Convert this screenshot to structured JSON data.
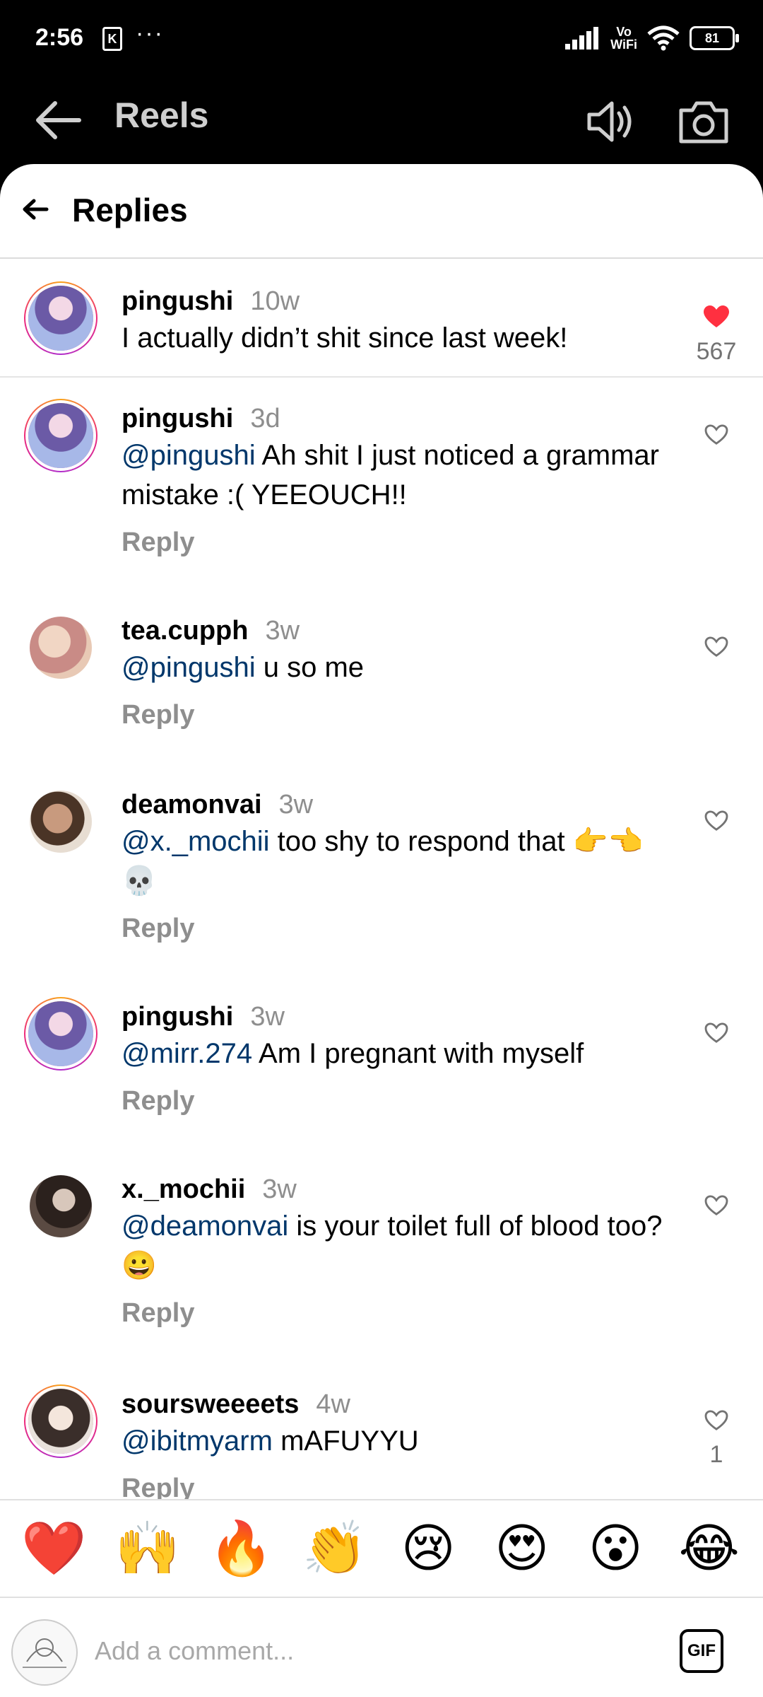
{
  "status_bar": {
    "time": "2:56",
    "k_badge": "K",
    "dots": "···",
    "vo_line1": "Vo",
    "vo_line2": "WiFi",
    "battery": "81"
  },
  "reels_header": {
    "title": "Reels",
    "back_icon": "arrow-left-icon",
    "sound_icon": "speaker-icon",
    "camera_icon": "camera-icon"
  },
  "sheet": {
    "title": "Replies",
    "back_icon": "arrow-left-icon"
  },
  "colors": {
    "mention": "#00376b",
    "like_active": "#ff3040",
    "meta_gray": "#8e8e8e"
  },
  "comments": [
    {
      "user": "pingushi",
      "time": "10w",
      "mention": "",
      "text": "I actually didn’t shit since last week!",
      "reply": "",
      "liked": true,
      "likes": "567"
    },
    {
      "user": "pingushi",
      "time": "3d",
      "mention": "@pingushi",
      "text": " Ah shit I just noticed a grammar mistake :( YEEOUCH!!",
      "reply": "Reply",
      "liked": false,
      "likes": ""
    },
    {
      "user": "tea.cupph",
      "time": "3w",
      "mention": "@pingushi",
      "text": " u so me",
      "reply": "Reply",
      "liked": false,
      "likes": ""
    },
    {
      "user": "deamonvai",
      "time": "3w",
      "mention": "@x._mochii",
      "text": " too shy to respond that 👉👈💀",
      "reply": "Reply",
      "liked": false,
      "likes": ""
    },
    {
      "user": "pingushi",
      "time": "3w",
      "mention": "@mirr.274",
      "text": " Am I pregnant with myself",
      "reply": "Reply",
      "liked": false,
      "likes": ""
    },
    {
      "user": "x._mochii",
      "time": "3w",
      "mention": "@deamonvai",
      "text": " is your toilet full of blood too? 😀",
      "reply": "Reply",
      "liked": false,
      "likes": ""
    },
    {
      "user": "soursweeeets",
      "time": "4w",
      "mention": "@ibitmyarm",
      "text": " mAFUYYU",
      "reply": "Reply",
      "liked": false,
      "likes": "1"
    }
  ],
  "emoji_bar": [
    "❤️",
    "🙌",
    "🔥",
    "👏",
    "😢",
    "😍",
    "😮",
    "😂"
  ],
  "input": {
    "placeholder": "Add a comment...",
    "gif_label": "GIF"
  }
}
